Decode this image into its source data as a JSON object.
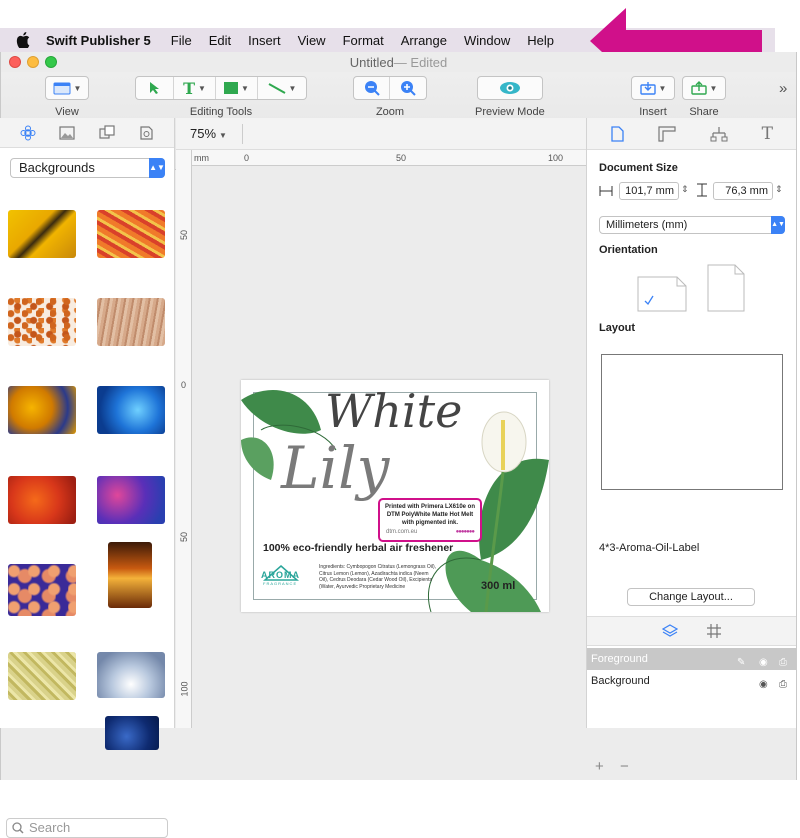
{
  "menubar": {
    "app_name": "Swift Publisher 5",
    "items": [
      "File",
      "Edit",
      "Insert",
      "View",
      "Format",
      "Arrange",
      "Window",
      "Help"
    ]
  },
  "window": {
    "title": "Untitled",
    "title_suffix": " — Edited"
  },
  "toolbar": {
    "view_label": "View",
    "editing_tools_label": "Editing Tools",
    "zoom_label": "Zoom",
    "preview_mode_label": "Preview Mode",
    "insert_label": "Insert",
    "share_label": "Share",
    "overflow": "»"
  },
  "left_panel": {
    "category": "Backgrounds",
    "search_placeholder": "Search"
  },
  "canvas": {
    "zoom": "75%",
    "ruler_unit": "mm",
    "h_ticks": [
      "0",
      "50",
      "100"
    ],
    "v_ticks": [
      "50",
      "0",
      "50",
      "100"
    ]
  },
  "label_artwork": {
    "title_1": "White",
    "title_2": "Lily",
    "badge_line1": "Printed with Primera LX610e on",
    "badge_line2": "DTM PolyWhite Matte Hot Melt",
    "badge_line3": "with pigmented ink.",
    "badge_url": "dtm.com.eu",
    "tagline": "100% eco-friendly herbal air freshener",
    "brand": "AROMA",
    "brand_sub": "FRAGRANCE",
    "ingredients": "Ingredients: Cymbopogon Citratus (Lemongrass Oil), Citrus Lemon (Lemon), Azadirachta indica (Neem Oil), Cedrus Deodara (Cedar Wood Oil), Excipients (Water, Ayurvedic Proprietary Medicine",
    "volume": "300 ml"
  },
  "right_panel": {
    "doc_size_title": "Document Size",
    "width_value": "101,7 mm",
    "height_value": "76,3 mm",
    "units": "Millimeters (mm)",
    "orientation_title": "Orientation",
    "layout_title": "Layout",
    "layout_name": "4*3-Aroma-Oil-Label",
    "change_layout_button": "Change Layout...",
    "layers": [
      "Foreground",
      "Background"
    ],
    "add_sign": "+",
    "remove_sign": "−"
  },
  "colors": {
    "arrow": "#d0108a",
    "menubar_bg": "#e7e0ea",
    "accent": "#3b82f6",
    "selected_layer_bg": "#c8c8c8"
  }
}
